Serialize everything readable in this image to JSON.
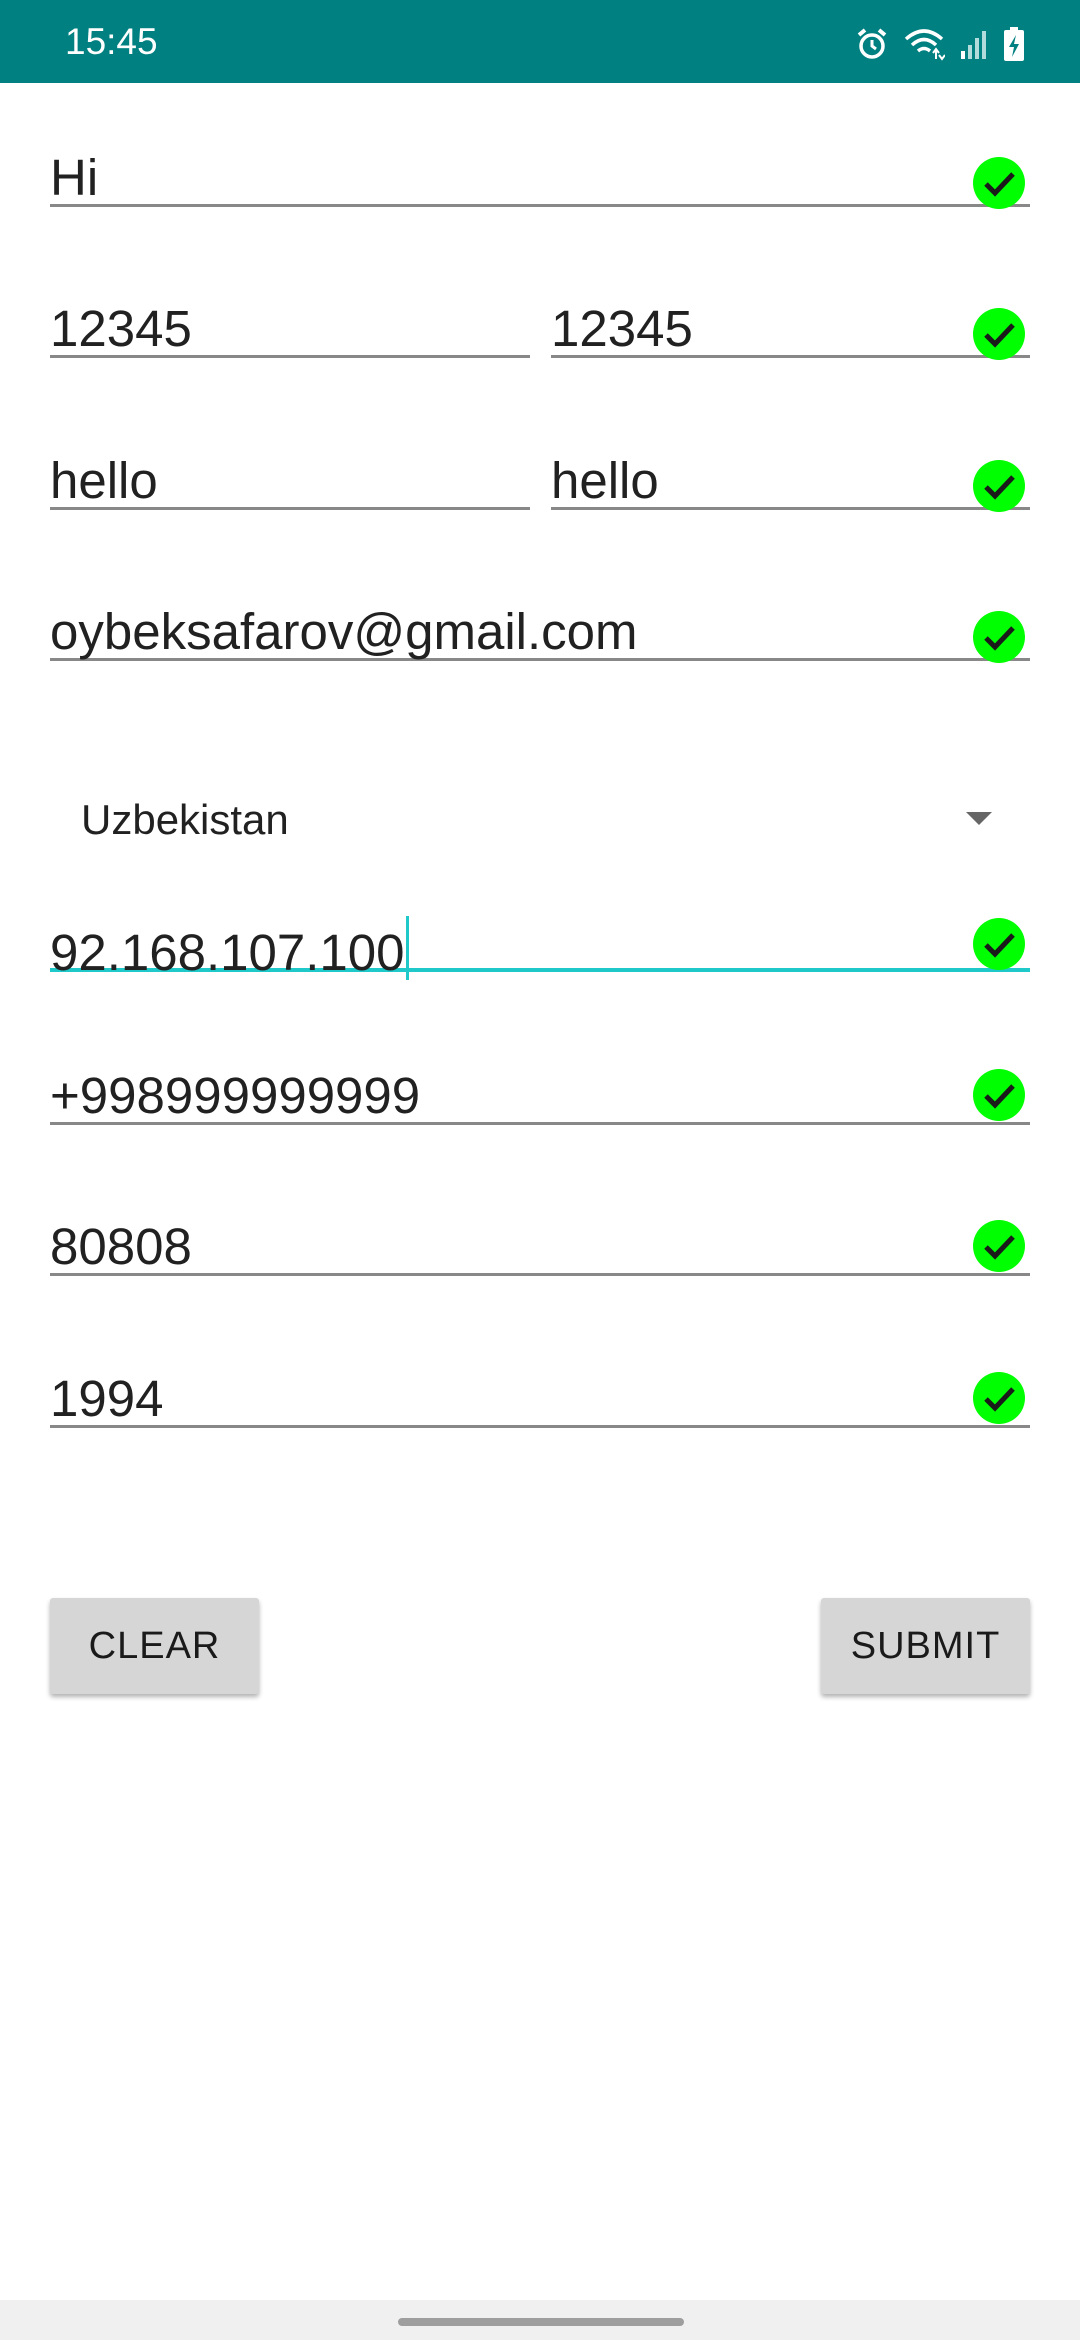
{
  "status_bar": {
    "time": "15:45",
    "icons": [
      "alarm-icon",
      "wifi-icon",
      "signal-icon",
      "battery-charging-icon"
    ]
  },
  "form": {
    "name": {
      "value": "Hi",
      "valid": true
    },
    "password": {
      "value": "12345"
    },
    "password_confirm": {
      "value": "12345",
      "valid": true
    },
    "word": {
      "value": "hello"
    },
    "word_confirm": {
      "value": "hello",
      "valid": true
    },
    "email": {
      "value": "oybeksafarov@gmail.com",
      "valid": true
    },
    "country": {
      "selected": "Uzbekistan"
    },
    "ip_address": {
      "value": "92.168.107.100",
      "valid": true,
      "focused": true
    },
    "phone": {
      "value": "+998999999999",
      "valid": true
    },
    "zip_code": {
      "value": "80808",
      "valid": true
    },
    "year": {
      "value": "1994",
      "valid": true
    }
  },
  "buttons": {
    "clear_label": "CLEAR",
    "submit_label": "SUBMIT"
  },
  "colors": {
    "status_bar": "#008080",
    "focus_underline": "#20c9c9",
    "valid_check": "#00ff00",
    "button_bg": "#d6d6d6"
  }
}
